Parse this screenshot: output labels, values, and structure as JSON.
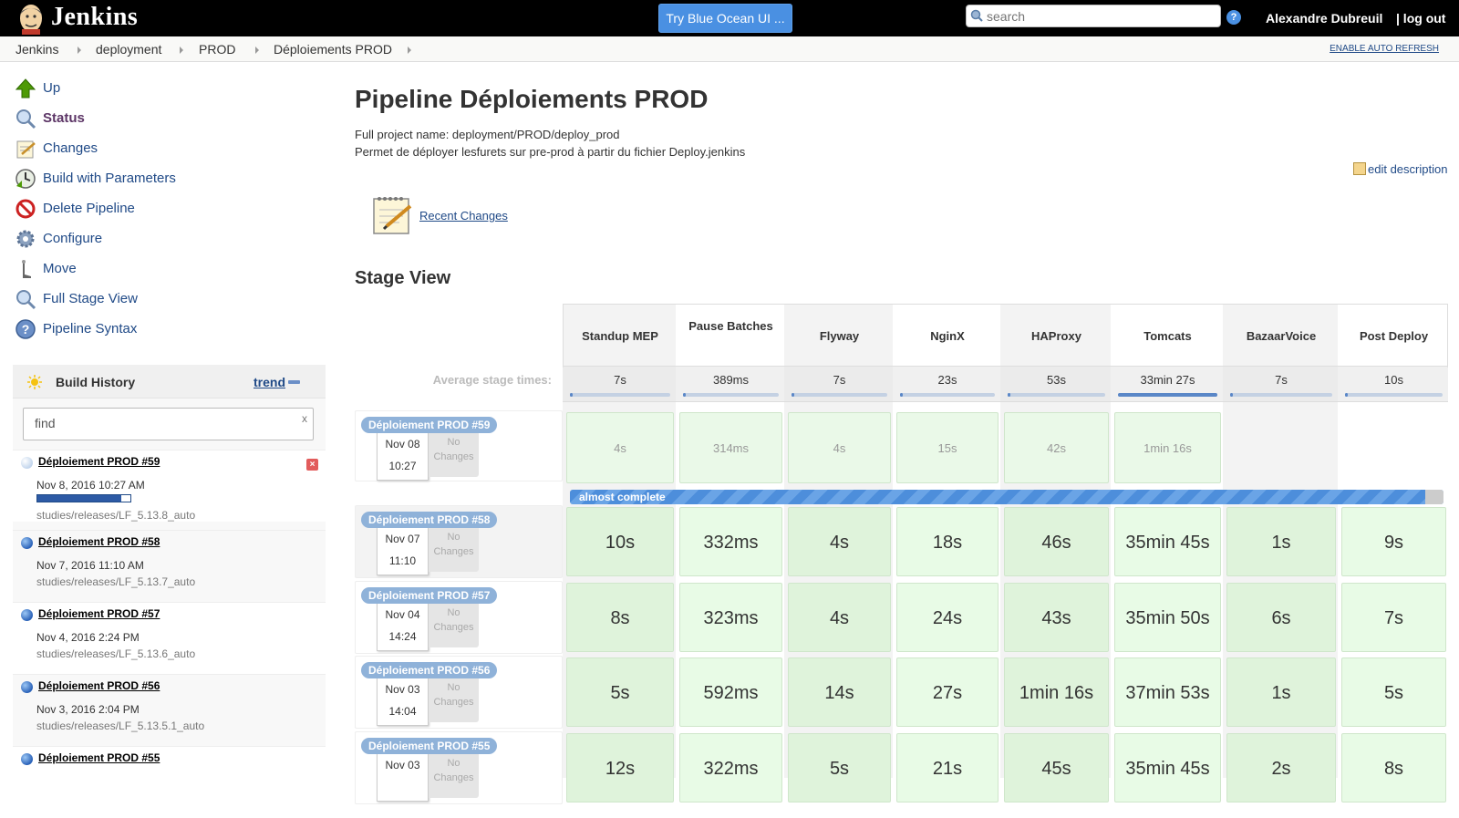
{
  "header": {
    "logo_text": "Jenkins",
    "blue_ocean_label": "Try Blue Ocean UI ...",
    "search_placeholder": "search",
    "help_label": "?",
    "user_name": "Alexandre Dubreuil",
    "logout_label": "| log out"
  },
  "breadcrumbs": [
    "Jenkins",
    "deployment",
    "PROD",
    "Déploiements PROD"
  ],
  "auto_refresh_label": "ENABLE AUTO REFRESH",
  "tasks": [
    {
      "label": "Up",
      "icon": "up-arrow-icon"
    },
    {
      "label": "Status",
      "icon": "magnifier-icon"
    },
    {
      "label": "Changes",
      "icon": "notepad-icon"
    },
    {
      "label": "Build with Parameters",
      "icon": "clock-icon"
    },
    {
      "label": "Delete Pipeline",
      "icon": "no-entry-icon"
    },
    {
      "label": "Configure",
      "icon": "gear-icon"
    },
    {
      "label": "Move",
      "icon": "move-icon"
    },
    {
      "label": "Full Stage View",
      "icon": "magnifier-icon"
    },
    {
      "label": "Pipeline Syntax",
      "icon": "help-icon"
    }
  ],
  "build_history": {
    "title": "Build History",
    "trend_label": "trend",
    "filter_value": "find",
    "clear_label": "x",
    "builds": [
      {
        "name": "Déploiement PROD #59",
        "date": "Nov 8, 2016 10:27 AM",
        "branch": "studies/releases/LF_5.13.8_auto",
        "running": true,
        "progress": 0.9
      },
      {
        "name": "Déploiement PROD #58",
        "date": "Nov 7, 2016 11:10 AM",
        "branch": "studies/releases/LF_5.13.7_auto"
      },
      {
        "name": "Déploiement PROD #57",
        "date": "Nov 4, 2016 2:24 PM",
        "branch": "studies/releases/LF_5.13.6_auto"
      },
      {
        "name": "Déploiement PROD #56",
        "date": "Nov 3, 2016 2:04 PM",
        "branch": "studies/releases/LF_5.13.5.1_auto"
      },
      {
        "name": "Déploiement PROD #55",
        "date": "",
        "branch": ""
      }
    ]
  },
  "main": {
    "title": "Pipeline Déploiements PROD",
    "full_name": "Full project name: deployment/PROD/deploy_prod",
    "description": "Permet de déployer lesfurets sur pre-prod à partir du fichier Deploy.jenkins",
    "edit_description": "edit description",
    "recent_changes": "Recent Changes",
    "stage_view_title": "Stage View"
  },
  "stage_view": {
    "avg_label": "Average stage times:",
    "progress_label": "almost complete",
    "no_changes": "No Changes",
    "stages": [
      {
        "name": "Standup MEP",
        "avg": "7s",
        "avg_ratio": 0.004
      },
      {
        "name": "Pause Batches",
        "avg": "389ms",
        "avg_ratio": 0.0002
      },
      {
        "name": "Flyway",
        "avg": "7s",
        "avg_ratio": 0.004
      },
      {
        "name": "NginX",
        "avg": "23s",
        "avg_ratio": 0.012
      },
      {
        "name": "HAProxy",
        "avg": "53s",
        "avg_ratio": 0.027
      },
      {
        "name": "Tomcats",
        "avg": "33min 27s",
        "avg_ratio": 1.0
      },
      {
        "name": "BazaarVoice",
        "avg": "7s",
        "avg_ratio": 0.004
      },
      {
        "name": "Post Deploy",
        "avg": "10s",
        "avg_ratio": 0.005
      }
    ],
    "runs": [
      {
        "label": "Déploiement PROD #59",
        "date": "Nov 08",
        "time": "10:27",
        "running": true,
        "cells": [
          "4s",
          "314ms",
          "4s",
          "15s",
          "42s",
          "1min 16s",
          "",
          ""
        ]
      },
      {
        "label": "Déploiement PROD #58",
        "date": "Nov 07",
        "time": "11:10",
        "cells": [
          "10s",
          "332ms",
          "4s",
          "18s",
          "46s",
          "35min 45s",
          "1s",
          "9s"
        ]
      },
      {
        "label": "Déploiement PROD #57",
        "date": "Nov 04",
        "time": "14:24",
        "cells": [
          "8s",
          "323ms",
          "4s",
          "24s",
          "43s",
          "35min 50s",
          "6s",
          "7s"
        ]
      },
      {
        "label": "Déploiement PROD #56",
        "date": "Nov 03",
        "time": "14:04",
        "cells": [
          "5s",
          "592ms",
          "14s",
          "27s",
          "1min 16s",
          "37min 53s",
          "1s",
          "5s"
        ]
      },
      {
        "label": "Déploiement PROD #55",
        "date": "Nov 03",
        "time": "",
        "cells": [
          "12s",
          "322ms",
          "5s",
          "21s",
          "45s",
          "35min 45s",
          "2s",
          "8s"
        ]
      }
    ]
  },
  "colors": {
    "header_bg": "#000000",
    "link": "#204a87",
    "blue_ocean": "#4a90e2",
    "success_cell": "#e8fbe6",
    "progress": "#4d8edb"
  }
}
